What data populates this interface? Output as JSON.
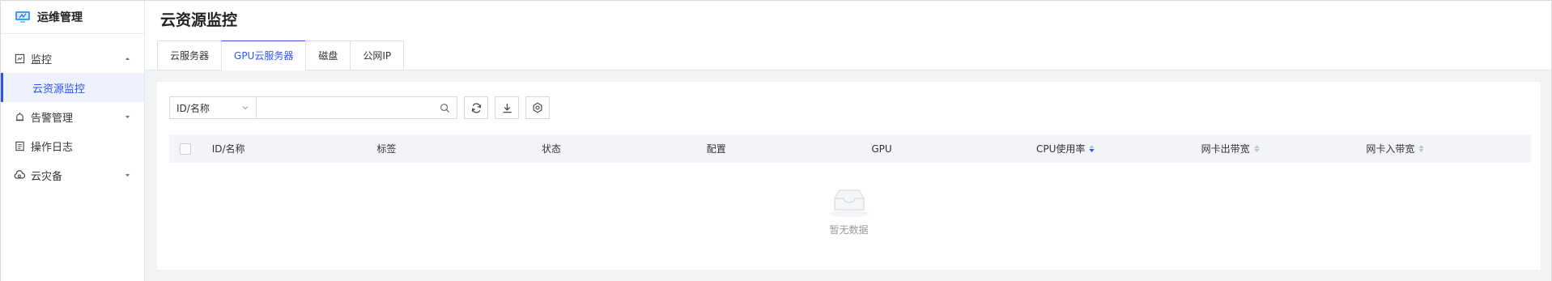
{
  "app": {
    "title": "运维管理"
  },
  "sidebar": {
    "items": [
      {
        "label": "监控",
        "icon": "monitor-icon",
        "expanded": true
      },
      {
        "label": "云资源监控",
        "active": true
      },
      {
        "label": "告警管理",
        "icon": "alarm-icon",
        "expanded": false
      },
      {
        "label": "操作日志",
        "icon": "log-icon"
      },
      {
        "label": "云灾备",
        "icon": "cloud-backup-icon",
        "expanded": false
      }
    ]
  },
  "page": {
    "title": "云资源监控",
    "tabs": [
      {
        "label": "云服务器"
      },
      {
        "label": "GPU云服务器",
        "active": true
      },
      {
        "label": "磁盘"
      },
      {
        "label": "公网IP"
      }
    ]
  },
  "toolbar": {
    "filter_select": "ID/名称",
    "search_value": "",
    "search_placeholder": "",
    "buttons": [
      "refresh-icon",
      "download-icon",
      "settings-icon"
    ]
  },
  "table": {
    "columns": [
      "ID/名称",
      "标签",
      "状态",
      "配置",
      "GPU",
      "CPU使用率",
      "网卡出带宽",
      "网卡入带宽"
    ],
    "sort": {
      "column": "CPU使用率",
      "direction": "desc"
    },
    "rows": [],
    "empty_text": "暂无数据"
  },
  "colors": {
    "accent": "#2f54eb",
    "header_bg": "#f2f4f7",
    "page_bg": "#f2f3f5"
  }
}
